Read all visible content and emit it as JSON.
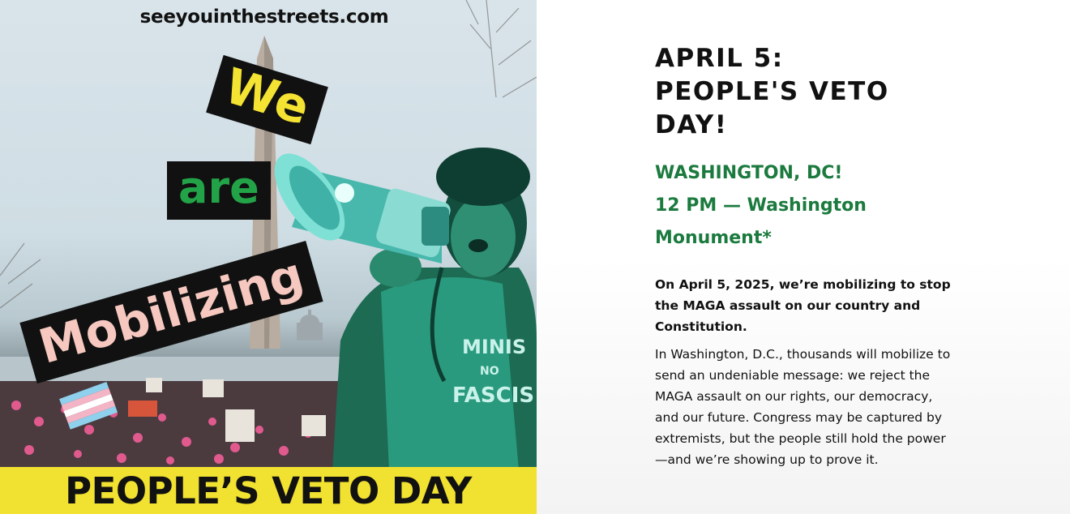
{
  "poster": {
    "site_url": "seeyouinthestreets.com",
    "cutout_we": "We",
    "cutout_are": "are",
    "cutout_mobilizing": "Mobilizing",
    "shirt_line1": "MINIS",
    "shirt_line2": "NO",
    "shirt_line3": "FASCIS",
    "banner": "PEOPLE’S VETO DAY",
    "colors": {
      "banner_yellow": "#f1e130",
      "megaphone_teal": "#5fcfc4",
      "protester_green": "#1f8a72",
      "cutout_black": "#111111"
    }
  },
  "article": {
    "headline_line1": "APRIL 5:",
    "headline_line2": "PEOPLE'S VETO",
    "headline_line3": "DAY!",
    "location": "WASHINGTON, DC!",
    "time_line1": "12 PM — Washington",
    "time_line2": "Monument*",
    "paragraph1": "On April 5, 2025, we’re mobilizing to stop the MAGA assault on our country and Constitution.",
    "paragraph2": "In Washington, D.C., thousands will mobilize to send an undeniable message: we reject the MAGA assault on our rights, our democracy, and our future. Congress may be captured by extremists, but the people still hold the power—and we’re showing up to prove it.",
    "accent_color": "#1b7a3e"
  }
}
